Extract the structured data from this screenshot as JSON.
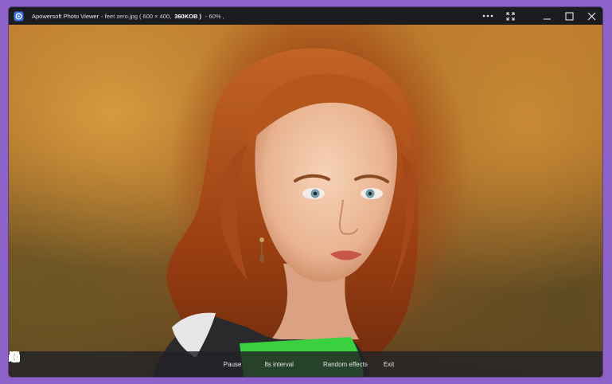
{
  "titlebar": {
    "app_name": "Apowersoft Photo Viewer",
    "file_name": "- feet zero.jpg",
    "dimensions": "( 600 × 400,",
    "file_size": "360KOB )",
    "zoom": "- 60% ,"
  },
  "window_controls": [
    "more-options",
    "fullscreen",
    "minimize",
    "maximize",
    "close"
  ],
  "slideshow_toolbar": {
    "pause_label": "Pause",
    "interval_label": "8s interval",
    "effects_label": "Random effects",
    "exit_label": "Exit"
  },
  "photo": {
    "subject": "portrait"
  },
  "colors": {
    "background": "#8e63c9",
    "titlebar": "#1b1c20",
    "toolbar": "#222226"
  }
}
